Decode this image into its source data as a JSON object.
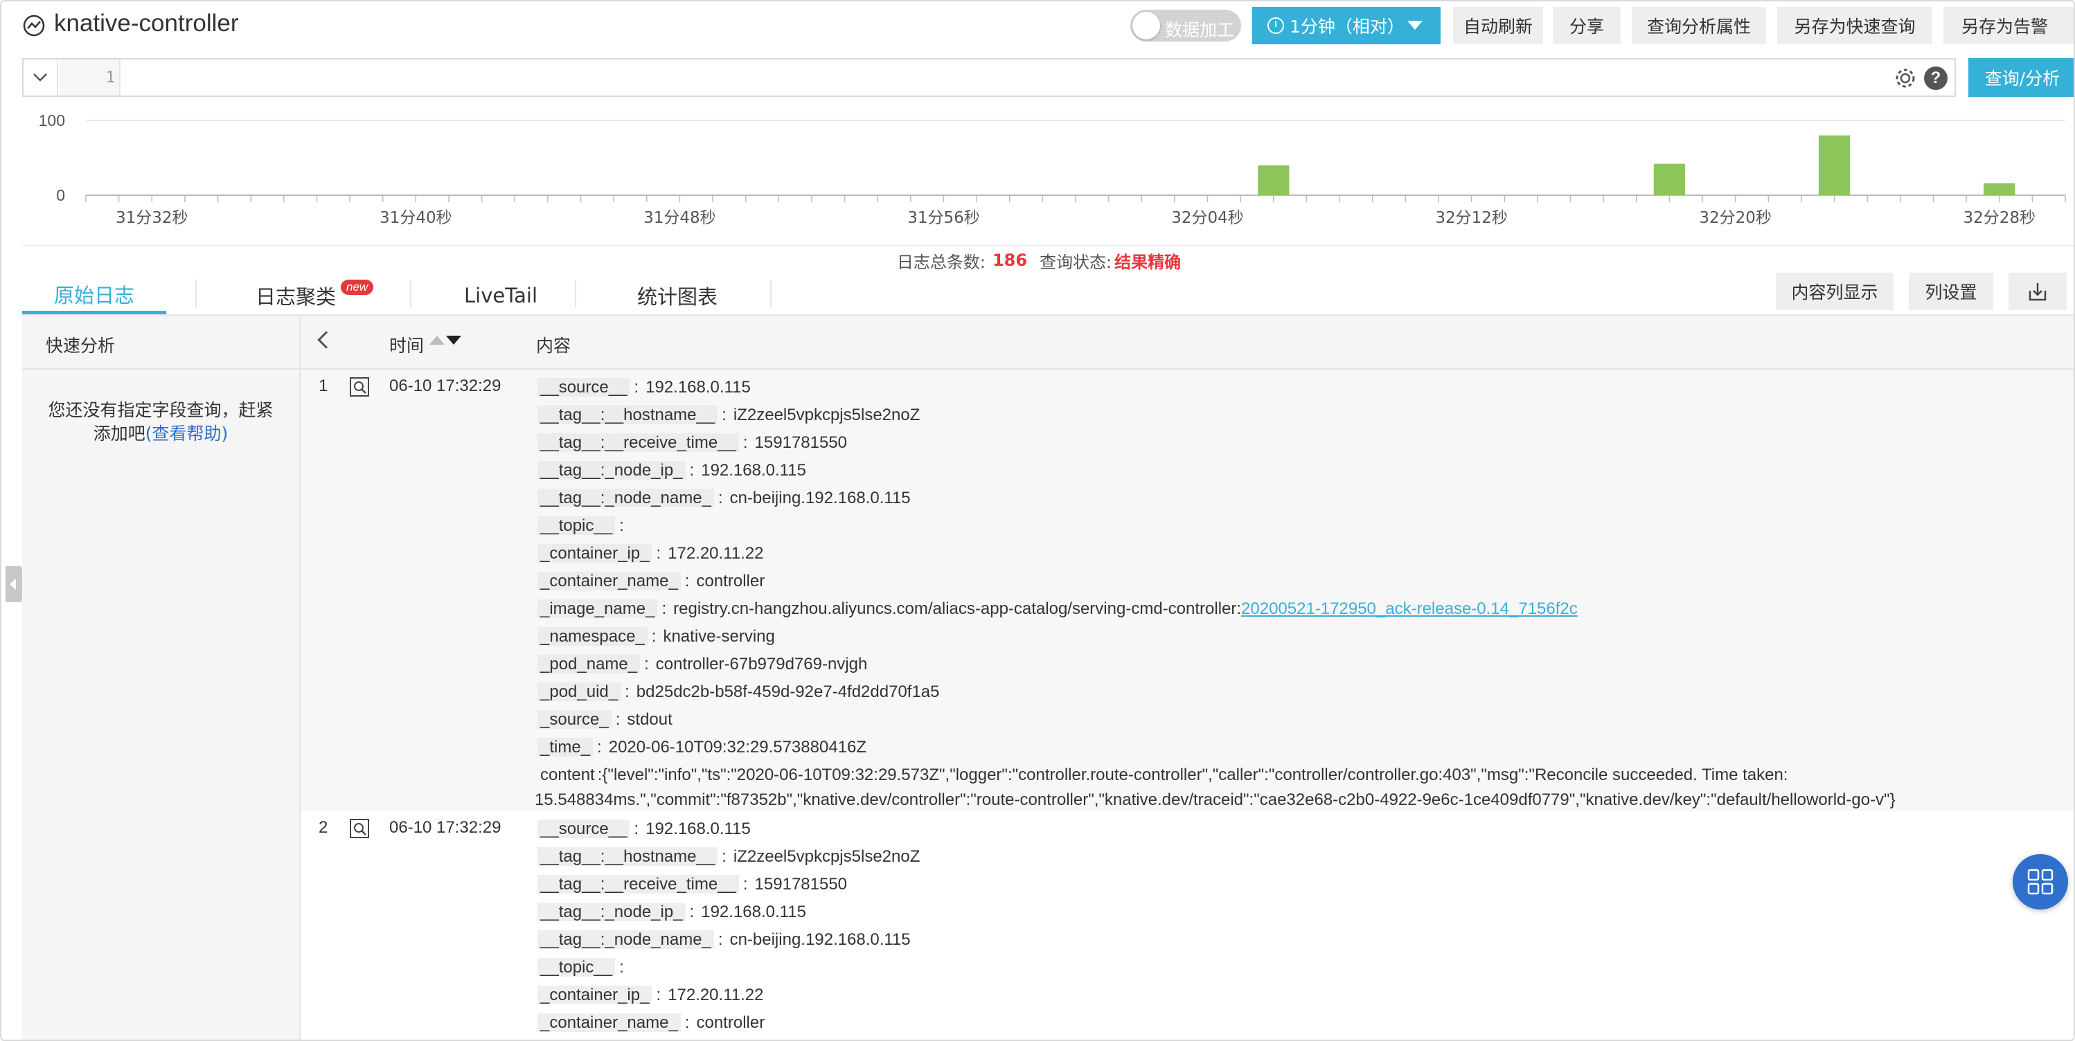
{
  "header": {
    "title": "knative-controller",
    "toggle_label": "数据加工",
    "time_range": "1分钟（相对）",
    "buttons": [
      "自动刷新",
      "分享",
      "查询分析属性",
      "另存为快速查询",
      "另存为告警"
    ]
  },
  "query": {
    "line_number": "1",
    "text": "",
    "submit_label": "查询/分析"
  },
  "histogram": {
    "y_labels": [
      "100",
      "0"
    ],
    "x_labels": [
      "31分32秒",
      "31分40秒",
      "31分48秒",
      "31分56秒",
      "32分04秒",
      "32分12秒",
      "32分20秒",
      "32分28秒"
    ],
    "bar_color": "#8cc65a"
  },
  "chart_data": {
    "type": "bar",
    "ylim": [
      0,
      100
    ],
    "x": [
      "32分06秒",
      "32分18秒",
      "32分23秒",
      "32分28秒"
    ],
    "values": [
      40,
      42,
      80,
      16
    ]
  },
  "summary": {
    "count_label": "日志总条数:",
    "count": "186",
    "state_label": "查询状态:",
    "state": "结果精确"
  },
  "tabs": [
    {
      "label": "原始日志",
      "active": true
    },
    {
      "label": "日志聚类",
      "badge": "new"
    },
    {
      "label": "LiveTail"
    },
    {
      "label": "统计图表"
    }
  ],
  "right_buttons": {
    "content_columns": "内容列显示",
    "column_settings": "列设置"
  },
  "quick_analysis": {
    "title": "快速分析",
    "message_line1": "您还没有指定字段查询，赶紧",
    "message_line2": "添加吧",
    "help_link": "(查看帮助)"
  },
  "table": {
    "col_time": "时间",
    "col_content": "内容"
  },
  "logs": [
    {
      "index": "1",
      "time": "06-10 17:32:29",
      "fields": [
        {
          "k": "__source__",
          "v": "192.168.0.115"
        },
        {
          "k": "__tag__:__hostname__",
          "v": "iZ2zeel5vpkcpjs5lse2noZ"
        },
        {
          "k": "__tag__:__receive_time__",
          "v": "1591781550"
        },
        {
          "k": "__tag__:_node_ip_",
          "v": "192.168.0.115"
        },
        {
          "k": "__tag__:_node_name_",
          "v": "cn-beijing.192.168.0.115"
        },
        {
          "k": "__topic__",
          "v": ""
        },
        {
          "k": "_container_ip_",
          "v": "172.20.11.22"
        },
        {
          "k": "_container_name_",
          "v": "controller"
        },
        {
          "k": "_image_name_",
          "v": "registry.cn-hangzhou.aliyuncs.com/aliacs-app-catalog/serving-cmd-controller:",
          "link": "20200521-172950_ack-release-0.14_7156f2c"
        },
        {
          "k": "_namespace_",
          "v": "knative-serving"
        },
        {
          "k": "_pod_name_",
          "v": "controller-67b979d769-nvjgh"
        },
        {
          "k": "_pod_uid_",
          "v": "bd25dc2b-b58f-459d-92e7-4fd2dd70f1a5"
        },
        {
          "k": "_source_",
          "v": "stdout"
        },
        {
          "k": "_time_",
          "v": "2020-06-10T09:32:29.573880416Z"
        }
      ],
      "content_key": "content",
      "content_line1": "{\"level\":\"info\",\"ts\":\"2020-06-10T09:32:29.573Z\",\"logger\":\"controller.route-controller\",\"caller\":\"controller/controller.go:403\",\"msg\":\"Reconcile succeeded. Time taken:",
      "content_line2": "15.548834ms.\",\"commit\":\"f87352b\",\"knative.dev/controller\":\"route-controller\",\"knative.dev/traceid\":\"cae32e68-c2b0-4922-9e6c-1ce409df0779\",\"knative.dev/key\":\"default/helloworld-go-v\"}"
    },
    {
      "index": "2",
      "time": "06-10 17:32:29",
      "fields": [
        {
          "k": "__source__",
          "v": "192.168.0.115"
        },
        {
          "k": "__tag__:__hostname__",
          "v": "iZ2zeel5vpkcpjs5lse2noZ"
        },
        {
          "k": "__tag__:__receive_time__",
          "v": "1591781550"
        },
        {
          "k": "__tag__:_node_ip_",
          "v": "192.168.0.115"
        },
        {
          "k": "__tag__:_node_name_",
          "v": "cn-beijing.192.168.0.115"
        },
        {
          "k": "__topic__",
          "v": ""
        },
        {
          "k": "_container_ip_",
          "v": "172.20.11.22"
        },
        {
          "k": "_container_name_",
          "v": "controller"
        }
      ]
    }
  ]
}
